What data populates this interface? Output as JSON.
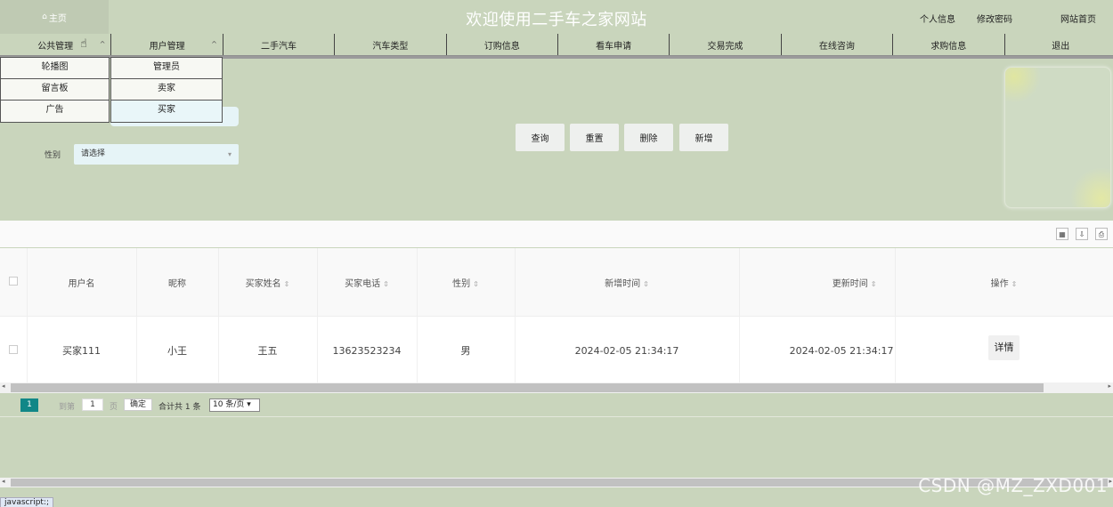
{
  "header": {
    "home_icon": "home-icon",
    "home_label": "主页",
    "title": "欢迎使用二手车之家网站",
    "links": [
      "个人信息",
      "修改密码",
      "网站首页"
    ]
  },
  "nav": {
    "items": [
      "公共管理",
      "用户管理",
      "二手汽车",
      "汽车类型",
      "订购信息",
      "看车申请",
      "交易完成",
      "在线咨询",
      "求购信息",
      "退出"
    ]
  },
  "dropdowns": {
    "public": [
      "轮播图",
      "留言板",
      "广告"
    ],
    "users": [
      "管理员",
      "卖家",
      "买家"
    ]
  },
  "search": {
    "gender_label": "性别",
    "gender_placeholder": "请选择",
    "buttons": [
      "查询",
      "重置",
      "删除",
      "新增"
    ]
  },
  "toolbar_icons": [
    "columns-icon",
    "export-icon",
    "print-icon"
  ],
  "table": {
    "columns": [
      "用户名",
      "昵称",
      "买家姓名",
      "买家电话",
      "性别",
      "新增时间",
      "更新时间",
      "操作"
    ],
    "rows": [
      {
        "username": "买家111",
        "nickname": "小王",
        "name": "王五",
        "phone": "13623523234",
        "gender": "男",
        "created": "2024-02-05 21:34:17",
        "updated": "2024-02-05 21:34:17",
        "action": "详情"
      }
    ]
  },
  "pager": {
    "current": "1",
    "goto_label": "到第",
    "page_input": "1",
    "page_unit": "页",
    "ok_label": "确定",
    "total": "合计共 1 条",
    "page_size": "10 条/页"
  },
  "status_text": "javascript:;",
  "watermark": "CSDN @MZ_ZXD001"
}
